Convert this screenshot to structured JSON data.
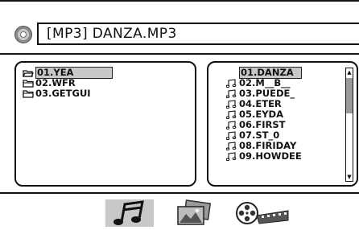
{
  "title_bar": {
    "text": "[MP3] DANZA.MP3",
    "icon": "disc-icon"
  },
  "folders": [
    {
      "label": "01.YEA",
      "selected": true,
      "icon": "open-folder-icon"
    },
    {
      "label": "02.WFR",
      "selected": false,
      "icon": "folder-icon"
    },
    {
      "label": "03.GETGUI",
      "selected": false,
      "icon": "folder-icon"
    }
  ],
  "files": [
    {
      "label": "01.DANZA",
      "selected": true,
      "icon": ""
    },
    {
      "label": "02.M__B__",
      "selected": false,
      "icon": "music-note-icon"
    },
    {
      "label": "03.PUEDE_",
      "selected": false,
      "icon": "music-note-icon"
    },
    {
      "label": "04.ETER",
      "selected": false,
      "icon": "music-note-icon"
    },
    {
      "label": "05.EYDA",
      "selected": false,
      "icon": "music-note-icon"
    },
    {
      "label": "06.FIRST",
      "selected": false,
      "icon": "music-note-icon"
    },
    {
      "label": "07.ST_0",
      "selected": false,
      "icon": "music-note-icon"
    },
    {
      "label": "08.FIRIDAY",
      "selected": false,
      "icon": "music-note-icon"
    },
    {
      "label": "09.HOWDEE",
      "selected": false,
      "icon": "music-note-icon"
    }
  ],
  "scrollbar": {
    "up_arrow": "▲",
    "down_arrow": "▼"
  },
  "media_tabs": [
    {
      "name": "music-tab",
      "icon": "music-icon",
      "selected": true
    },
    {
      "name": "photo-tab",
      "icon": "photo-icon",
      "selected": false
    },
    {
      "name": "video-tab",
      "icon": "film-reel-icon",
      "selected": false
    }
  ],
  "colors": {
    "selection": "#c8c8c8",
    "border": "#111111",
    "background": "#ffffff"
  }
}
